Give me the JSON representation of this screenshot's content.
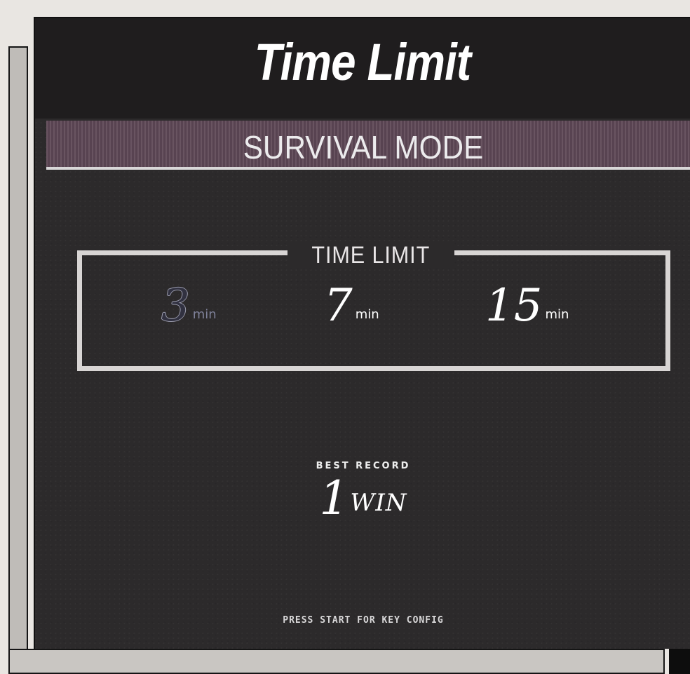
{
  "header": {
    "title": "Time Limit",
    "mode": "SURVIVAL MODE"
  },
  "time_limit": {
    "label": "TIME LIMIT",
    "options": [
      {
        "value": "3",
        "unit": "min",
        "selected": true
      },
      {
        "value": "7",
        "unit": "min",
        "selected": false
      },
      {
        "value": "15",
        "unit": "min",
        "selected": false
      }
    ]
  },
  "best_record": {
    "label": "BEST RECORD",
    "value": "1",
    "unit": "WIN"
  },
  "footer": {
    "hint": "PRESS START FOR KEY CONFIG"
  },
  "colors": {
    "screen_background": "#2c2a2b",
    "title_band": "#1f1d1e",
    "mode_band": "#5c4654",
    "border": "#d8d5d4",
    "selected_option": "#313140"
  },
  "icons": []
}
